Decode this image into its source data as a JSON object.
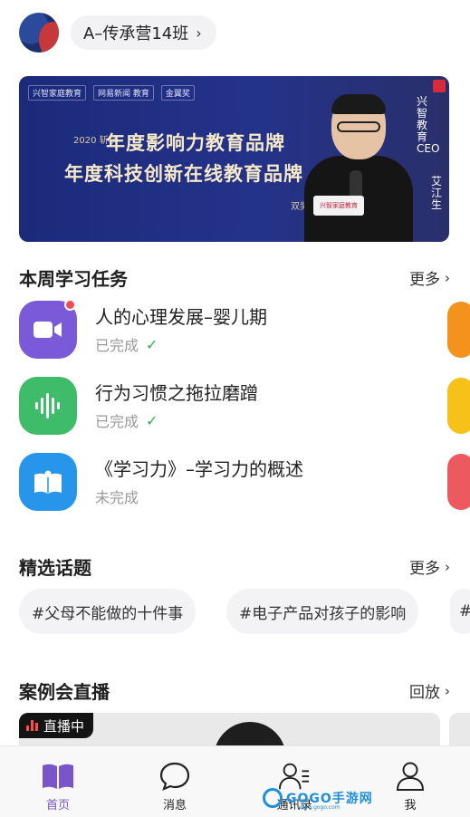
{
  "header": {
    "class_name": "A–传承营14班"
  },
  "banner": {
    "logos": [
      "兴智家庭教育",
      "网易新闻 教育",
      "金翼奖"
    ],
    "line1": "年度影响力教育品牌",
    "line2": "年度科技创新在线教育品牌",
    "small_left": "2020 斩获",
    "small_right": "双奖项",
    "vertical_title": "兴智教育CEO",
    "vertical_name": "艾江生",
    "card_text": "兴智家庭教育"
  },
  "tasks_section": {
    "title": "本周学习任务",
    "more": "更多"
  },
  "tasks": [
    {
      "title": "人的心理发展–婴儿期",
      "status": "已完成",
      "done": true,
      "icon": "video-camera-icon",
      "color": "#7b5ad9",
      "has_dot": true
    },
    {
      "title": "行为习惯之拖拉磨蹭",
      "status": "已完成",
      "done": true,
      "icon": "audio-wave-icon",
      "color": "#3ebc6a",
      "has_dot": false
    },
    {
      "title": "《学习力》–学习力的概述",
      "status": "未完成",
      "done": false,
      "icon": "open-book-icon",
      "color": "#2795e9",
      "has_dot": false
    }
  ],
  "topics_section": {
    "title": "精选话题",
    "more": "更多"
  },
  "topics": [
    "#父母不能做的十件事",
    "#电子产品对孩子的影响",
    "#"
  ],
  "live_section": {
    "title": "案例会直播",
    "more": "回放",
    "badge": "直播中"
  },
  "bottom_nav": [
    {
      "label": "首页",
      "icon": "book-icon",
      "active": true
    },
    {
      "label": "消息",
      "icon": "chat-bubble-icon",
      "active": false
    },
    {
      "label": "通讯录",
      "icon": "contacts-icon",
      "active": false
    },
    {
      "label": "我",
      "icon": "person-icon",
      "active": false
    }
  ],
  "watermark": {
    "text": "GOGO手游网",
    "sub": "www.gogo.com"
  },
  "colors": {
    "accent": "#7a55c9",
    "check": "#2bb34a",
    "dot": "#f24b55"
  }
}
